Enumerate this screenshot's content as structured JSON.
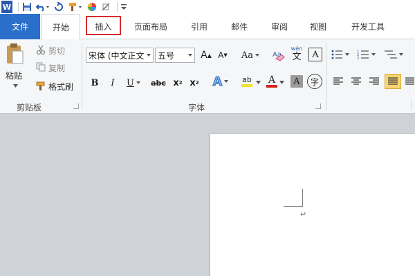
{
  "quick_access": {
    "word_logo_letter": "W"
  },
  "tabs": [
    {
      "label": "文件"
    },
    {
      "label": "开始"
    },
    {
      "label": "插入"
    },
    {
      "label": "页面布局"
    },
    {
      "label": "引用"
    },
    {
      "label": "邮件"
    },
    {
      "label": "审阅"
    },
    {
      "label": "视图"
    },
    {
      "label": "开发工具"
    }
  ],
  "highlighted_tab": "插入",
  "clipboard": {
    "paste_label": "粘贴",
    "cut_label": "剪切",
    "copy_label": "复制",
    "format_painter_label": "格式刷",
    "group_label": "剪贴板"
  },
  "font": {
    "font_name": "宋体 (中文正文",
    "font_size": "五号",
    "grow_glyph": "A",
    "shrink_glyph": "A",
    "case_glyph": "Aa",
    "bold_glyph": "B",
    "italic_glyph": "I",
    "underline_glyph": "U",
    "strike_glyph": "abc",
    "subscript_glyph": "x",
    "superscript_glyph": "x",
    "sub_mark": "2",
    "sup_mark": "2",
    "text_effect_glyph": "A",
    "highlight_glyph": "ab",
    "font_color_glyph": "A",
    "char_shading_glyph": "A",
    "enclosed_glyph": "字",
    "pinyin_glyph": "wén",
    "pinyin_base": "文",
    "border_glyph": "A",
    "group_label": "字体"
  },
  "colors": {
    "file_tab": "#2a6fc9",
    "highlight_box": "#d42d2d",
    "font_color_bar": "#d62020",
    "highlight_bar": "#f2e12a",
    "align_active": "#f7d572"
  },
  "document": {
    "paragraph_mark": "↵"
  }
}
